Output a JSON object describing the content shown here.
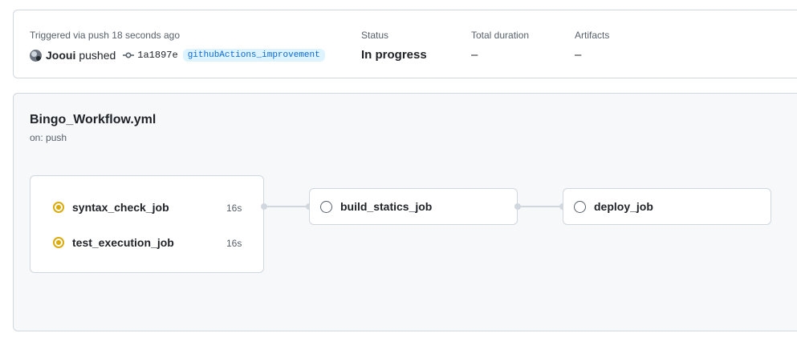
{
  "summary": {
    "triggered": "Triggered via push 18 seconds ago",
    "actor": "Jooui",
    "action": "pushed",
    "commit_sha": "1a1897e",
    "branch": "githubActions_improvement",
    "status_label": "Status",
    "status_value": "In progress",
    "duration_label": "Total duration",
    "duration_value": "–",
    "artifacts_label": "Artifacts",
    "artifacts_value": "–"
  },
  "workflow": {
    "file": "Bingo_Workflow.yml",
    "trigger": "on: push",
    "jobs": [
      {
        "name": "syntax_check_job",
        "duration": "16s",
        "status": "in_progress"
      },
      {
        "name": "test_execution_job",
        "duration": "16s",
        "status": "in_progress"
      },
      {
        "name": "build_statics_job",
        "duration": "",
        "status": "queued"
      },
      {
        "name": "deploy_job",
        "duration": "",
        "status": "queued"
      }
    ]
  },
  "colors": {
    "in_progress": "#dbab09",
    "queued": "#57606a",
    "link": "#0969da",
    "branch_bg": "#ddf4ff"
  },
  "icons": {
    "commit": "git-commit-icon",
    "in_progress": "status-in-progress-icon",
    "queued": "status-queued-icon",
    "avatar": "avatar"
  }
}
